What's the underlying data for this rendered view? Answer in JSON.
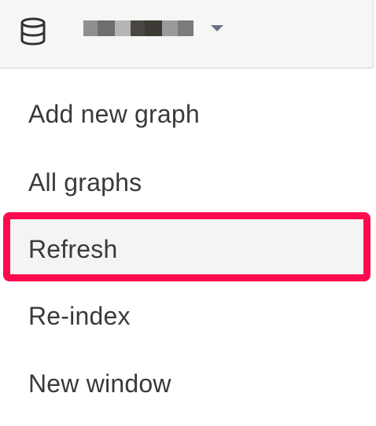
{
  "header": {
    "database_icon": "database-icon",
    "graph_name_obscured": true,
    "dropdown_icon": "chevron-down-icon",
    "blur_colors": [
      "#8f8f8f",
      "#6e6e6e",
      "#b5b5b5",
      "#4a4540",
      "#3d3a36",
      "#9a9a9a",
      "#7b7b7b"
    ]
  },
  "menu": {
    "items": [
      {
        "label": "Add new graph",
        "highlighted": false
      },
      {
        "label": "All graphs",
        "highlighted": false
      },
      {
        "label": "Refresh",
        "highlighted": true
      },
      {
        "label": "Re-index",
        "highlighted": false
      },
      {
        "label": "New window",
        "highlighted": false
      }
    ]
  },
  "colors": {
    "highlight_border": "#ff0a4e",
    "text": "#3a3a3a",
    "header_bg": "#f6f6f6",
    "chevron": "#6a7385"
  }
}
